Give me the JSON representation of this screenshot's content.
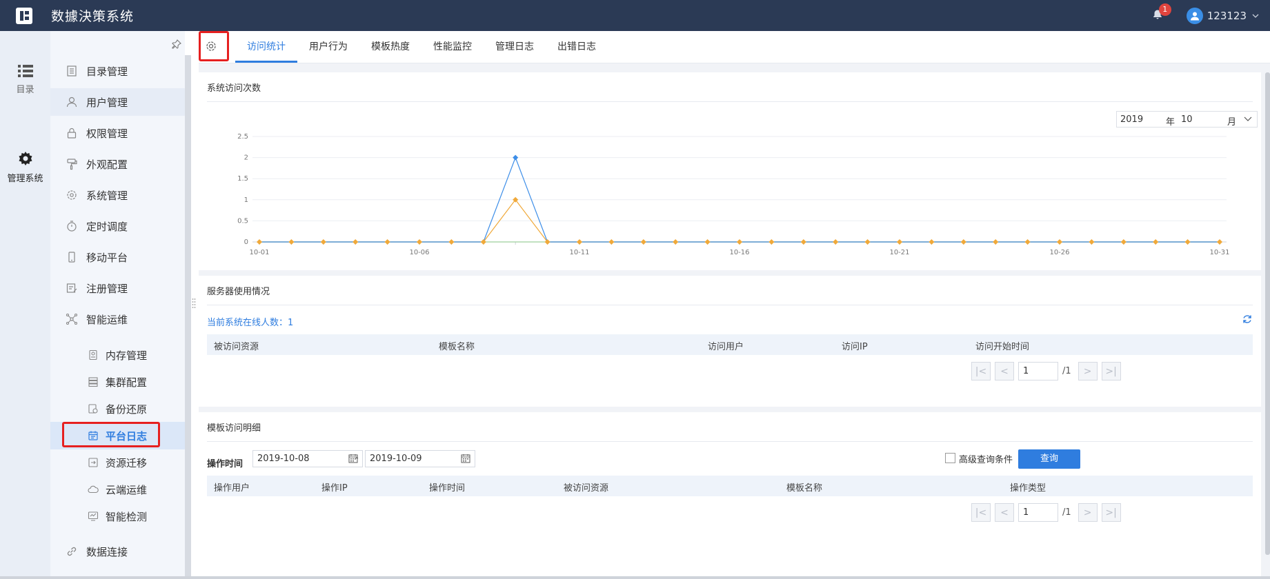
{
  "header": {
    "title": "数據決策系统",
    "notification_count": "1",
    "username": "123123"
  },
  "rail": {
    "items": [
      {
        "label": "目录",
        "icon": "list-icon"
      },
      {
        "label": "管理系统",
        "icon": "gear-icon"
      }
    ]
  },
  "menu": {
    "items": [
      {
        "label": "目录管理",
        "icon": "catalog-icon"
      },
      {
        "label": "用户管理",
        "icon": "user-icon"
      },
      {
        "label": "权限管理",
        "icon": "lock-icon"
      },
      {
        "label": "外观配置",
        "icon": "paint-roller-icon"
      },
      {
        "label": "系统管理",
        "icon": "settings-icon"
      },
      {
        "label": "定时调度",
        "icon": "timer-icon"
      },
      {
        "label": "移动平台",
        "icon": "mobile-icon"
      },
      {
        "label": "注册管理",
        "icon": "register-icon"
      },
      {
        "label": "智能运维",
        "icon": "network-icon"
      },
      {
        "label": "数据连接",
        "icon": "link-icon"
      }
    ],
    "sub_items": [
      {
        "label": "内存管理",
        "icon": "memory-icon"
      },
      {
        "label": "集群配置",
        "icon": "cluster-icon"
      },
      {
        "label": "备份还原",
        "icon": "backup-icon"
      },
      {
        "label": "平台日志",
        "icon": "calendar-log-icon"
      },
      {
        "label": "资源迁移",
        "icon": "migrate-icon"
      },
      {
        "label": "云端运维",
        "icon": "cloud-icon"
      },
      {
        "label": "智能检测",
        "icon": "monitor-icon"
      }
    ]
  },
  "tabs": [
    {
      "label": "访问统计"
    },
    {
      "label": "用户行为"
    },
    {
      "label": "模板热度"
    },
    {
      "label": "性能监控"
    },
    {
      "label": "管理日志"
    },
    {
      "label": "出错日志"
    }
  ],
  "visit_card": {
    "title": "系统访问次数",
    "year": "2019",
    "year_unit": "年",
    "month": "10",
    "month_unit": "月"
  },
  "chart_data": {
    "type": "line",
    "x": [
      "10-01",
      "10-02",
      "10-03",
      "10-04",
      "10-05",
      "10-06",
      "10-07",
      "10-08",
      "10-09",
      "10-10",
      "10-11",
      "10-12",
      "10-13",
      "10-14",
      "10-15",
      "10-16",
      "10-17",
      "10-18",
      "10-19",
      "10-20",
      "10-21",
      "10-22",
      "10-23",
      "10-24",
      "10-25",
      "10-26",
      "10-27",
      "10-28",
      "10-29",
      "10-30",
      "10-31"
    ],
    "x_tick_labels": [
      "10-01",
      "10-06",
      "10-11",
      "10-16",
      "10-21",
      "10-26",
      "10-31"
    ],
    "y_tick_labels": [
      "0",
      "0.5",
      "1",
      "1.5",
      "2",
      "2.5"
    ],
    "ylim": [
      0,
      2.5
    ],
    "series": [
      {
        "values": [
          0,
          0,
          0,
          0,
          0,
          0,
          0,
          0,
          2,
          0,
          0,
          0,
          0,
          0,
          0,
          0,
          0,
          0,
          0,
          0,
          0,
          0,
          0,
          0,
          0,
          0,
          0,
          0,
          0,
          0,
          0
        ],
        "color": "#3d8ee8",
        "marker": "diamond"
      },
      {
        "values": [
          0,
          0,
          0,
          0,
          0,
          0,
          0,
          0,
          1,
          0,
          0,
          0,
          0,
          0,
          0,
          0,
          0,
          0,
          0,
          0,
          0,
          0,
          0,
          0,
          0,
          0,
          0,
          0,
          0,
          0,
          0
        ],
        "color": "#f0a93a",
        "marker": "diamond"
      },
      {
        "values": [
          0,
          0,
          0,
          0,
          0,
          0,
          0,
          0,
          0,
          0,
          0,
          0,
          0,
          0,
          0,
          0,
          0,
          0,
          0,
          0,
          0,
          0,
          0,
          0,
          0,
          0,
          0,
          0,
          0,
          0,
          0
        ],
        "color": "#9ccf9a",
        "marker": "none"
      }
    ],
    "grid": true,
    "legend": "none"
  },
  "server_card": {
    "title": "服务器使用情况",
    "online_text": "当前系统在线人数：1",
    "columns": [
      "被访问资源",
      "模板名称",
      "访问用户",
      "访问IP",
      "访问开始时间"
    ],
    "page_value": "1",
    "page_total": "/1"
  },
  "template_card": {
    "title": "模板访问明细",
    "time_label": "操作时间",
    "date_from": "2019-10-08",
    "date_to": "2019-10-09",
    "dash": "-",
    "advanced_label": "高级查询条件",
    "query_button": "查询",
    "columns": [
      "操作用户",
      "操作IP",
      "操作时间",
      "被访问资源",
      "模板名称",
      "操作类型"
    ],
    "page_value": "1",
    "page_total": "/1"
  },
  "colors": {
    "header_bg": "#2b3a55",
    "accent": "#2f7ddf",
    "highlight": "#e62020"
  }
}
